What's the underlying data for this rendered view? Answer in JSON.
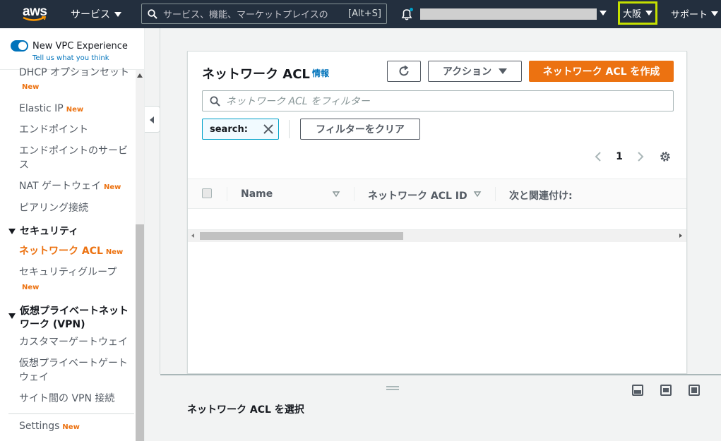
{
  "topnav": {
    "logo": "aws",
    "services_label": "サービス",
    "search_placeholder": "サービス、機能、マーケットプレイスの",
    "search_shortcut": "[Alt+S]",
    "region_label": "大阪",
    "support_label": "サポート"
  },
  "sidebar": {
    "toggle_label": "New VPC Experience",
    "tell_us": "Tell us what you think",
    "new_badge": "New",
    "items": [
      {
        "label": "DHCP オプションセット",
        "badge": "New"
      },
      {
        "label": "Elastic IP",
        "badge": "New"
      },
      {
        "label": "エンドポイント",
        "badge": ""
      },
      {
        "label": "エンドポイントのサービス",
        "badge": ""
      },
      {
        "label": "NAT ゲートウェイ",
        "badge": "New"
      },
      {
        "label": "ピアリング接続",
        "badge": ""
      }
    ],
    "security_section": "セキュリティ",
    "security_items": [
      {
        "label": "ネットワーク ACL",
        "badge": "New"
      },
      {
        "label": "セキュリティグループ",
        "badge": "New"
      }
    ],
    "vpn_section": "仮想プライベートネットワーク (VPN)",
    "vpn_items": [
      {
        "label": "カスタマーゲートウェイ"
      },
      {
        "label": "仮想プライベートゲートウェイ"
      },
      {
        "label": "サイト間の VPN 接続"
      }
    ],
    "settings_label": "Settings",
    "settings_badge": "New"
  },
  "panel": {
    "title": "ネットワーク ACL",
    "info": "情報",
    "actions_label": "アクション",
    "create_label": "ネットワーク ACL を作成",
    "filter_placeholder": "ネットワーク ACL をフィルター",
    "token_label": "search:",
    "clear_filters_label": "フィルターをクリア",
    "page_number": "1",
    "columns": [
      "Name",
      "ネットワーク ACL ID",
      "次と関連付け:"
    ]
  },
  "split_panel": {
    "title": "ネットワーク ACL を選択"
  },
  "colors": {
    "nav_bg": "#232f3e",
    "accent_orange": "#ec7211",
    "link_blue": "#0073bb",
    "region_highlight": "#c5e000"
  }
}
